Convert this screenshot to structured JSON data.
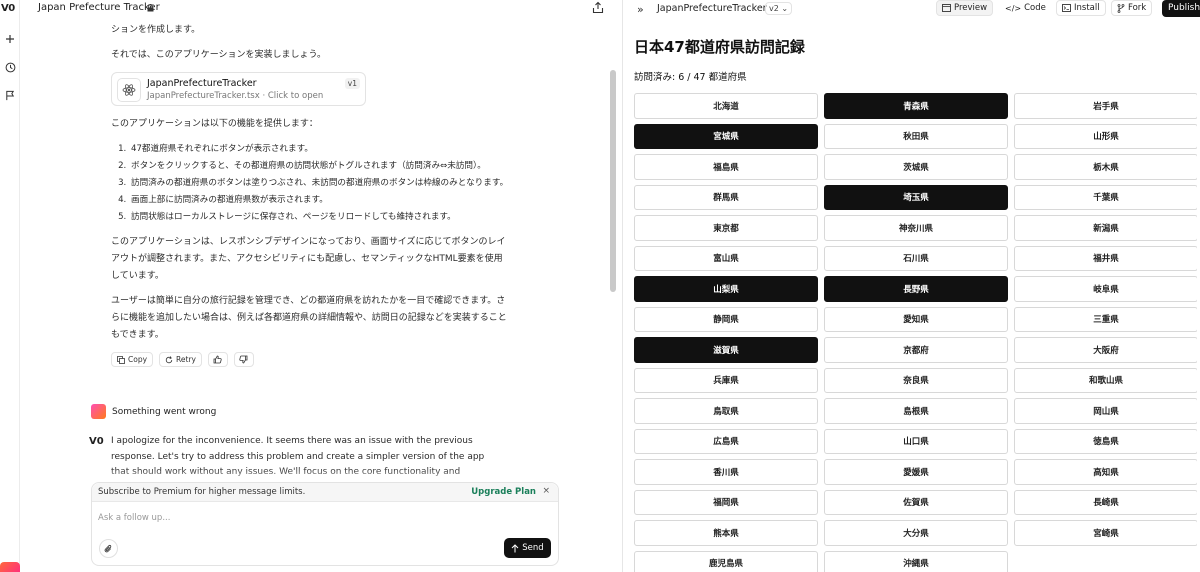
{
  "rail": {
    "logo": "V0"
  },
  "chat": {
    "title": "Japan Prefecture Tracker",
    "intro_tail": "ションを作成します。",
    "intro2": "それでは、このアプリケーションを実装しましょう。",
    "file_card": {
      "name": "JapanPrefectureTracker",
      "sub": "JapanPrefectureTracker.tsx · Click to open",
      "version": "v1"
    },
    "features_intro": "このアプリケーションは以下の機能を提供します：",
    "features": [
      "47都道府県それぞれにボタンが表示されます。",
      "ボタンをクリックすると、その都道府県の訪問状態がトグルされます（訪問済み⇔未訪問）。",
      "訪問済みの都道府県のボタンは塗りつぶされ、未訪問の都道府県のボタンは枠線のみとなります。",
      "画面上部に訪問済みの都道府県数が表示されます。",
      "訪問状態はローカルストレージに保存され、ページをリロードしても維持されます。"
    ],
    "para_responsive": "このアプリケーションは、レスポンシブデザインになっており、画面サイズに応じてボタンのレイアウトが調整されます。また、アクセシビリティにも配慮し、セマンティックなHTML要素を使用しています。",
    "para_user": "ユーザーは簡単に自分の旅行記録を管理でき、どの都道府県を訪れたかを一目で確認できます。さらに機能を追加したい場合は、例えば各都道府県の詳細情報や、訪問日の記録などを実装することもできます。",
    "actions": {
      "copy": "Copy",
      "retry": "Retry"
    },
    "error_message": "Something went wrong",
    "bot_logo": "V0",
    "bot_reply": "I apologize for the inconvenience. It seems there was an issue with the previous response. Let's try to address this problem and create a simpler version of the app that should work without any issues. We'll focus on the core functionality and minimize potential points of",
    "composer": {
      "promo": "Subscribe to Premium for higher message limits.",
      "upgrade": "Upgrade Plan",
      "close": "×",
      "placeholder": "Ask a follow up...",
      "send": "Send"
    }
  },
  "preview": {
    "name": "JapanPrefectureTracker",
    "version": "v2",
    "tabs": {
      "preview": "Preview",
      "code": "Code",
      "install": "Install",
      "fork": "Fork",
      "publish": "Publish"
    },
    "title": "日本47都道府県訪問記録",
    "count_text": "訪問済み: 6 / 47 都道府県",
    "prefectures": [
      {
        "name": "北海道",
        "visited": false
      },
      {
        "name": "青森県",
        "visited": true
      },
      {
        "name": "岩手県",
        "visited": false
      },
      {
        "name": "宮城県",
        "visited": true
      },
      {
        "name": "秋田県",
        "visited": false
      },
      {
        "name": "山形県",
        "visited": false
      },
      {
        "name": "福島県",
        "visited": false
      },
      {
        "name": "茨城県",
        "visited": false
      },
      {
        "name": "栃木県",
        "visited": false
      },
      {
        "name": "群馬県",
        "visited": false
      },
      {
        "name": "埼玉県",
        "visited": true
      },
      {
        "name": "千葉県",
        "visited": false
      },
      {
        "name": "東京都",
        "visited": false
      },
      {
        "name": "神奈川県",
        "visited": false
      },
      {
        "name": "新潟県",
        "visited": false
      },
      {
        "name": "富山県",
        "visited": false
      },
      {
        "name": "石川県",
        "visited": false
      },
      {
        "name": "福井県",
        "visited": false
      },
      {
        "name": "山梨県",
        "visited": true
      },
      {
        "name": "長野県",
        "visited": true
      },
      {
        "name": "岐阜県",
        "visited": false
      },
      {
        "name": "静岡県",
        "visited": false
      },
      {
        "name": "愛知県",
        "visited": false
      },
      {
        "name": "三重県",
        "visited": false
      },
      {
        "name": "滋賀県",
        "visited": true
      },
      {
        "name": "京都府",
        "visited": false
      },
      {
        "name": "大阪府",
        "visited": false
      },
      {
        "name": "兵庫県",
        "visited": false
      },
      {
        "name": "奈良県",
        "visited": false
      },
      {
        "name": "和歌山県",
        "visited": false
      },
      {
        "name": "鳥取県",
        "visited": false
      },
      {
        "name": "島根県",
        "visited": false
      },
      {
        "name": "岡山県",
        "visited": false
      },
      {
        "name": "広島県",
        "visited": false
      },
      {
        "name": "山口県",
        "visited": false
      },
      {
        "name": "徳島県",
        "visited": false
      },
      {
        "name": "香川県",
        "visited": false
      },
      {
        "name": "愛媛県",
        "visited": false
      },
      {
        "name": "高知県",
        "visited": false
      },
      {
        "name": "福岡県",
        "visited": false
      },
      {
        "name": "佐賀県",
        "visited": false
      },
      {
        "name": "長崎県",
        "visited": false
      },
      {
        "name": "熊本県",
        "visited": false
      },
      {
        "name": "大分県",
        "visited": false
      },
      {
        "name": "宮崎県",
        "visited": false
      },
      {
        "name": "鹿児島県",
        "visited": false
      },
      {
        "name": "沖縄県",
        "visited": false
      }
    ]
  },
  "colors": {
    "visited_fill": "#111111",
    "upgrade_link": "#1a7f5a",
    "publish_bg": "#111111"
  }
}
